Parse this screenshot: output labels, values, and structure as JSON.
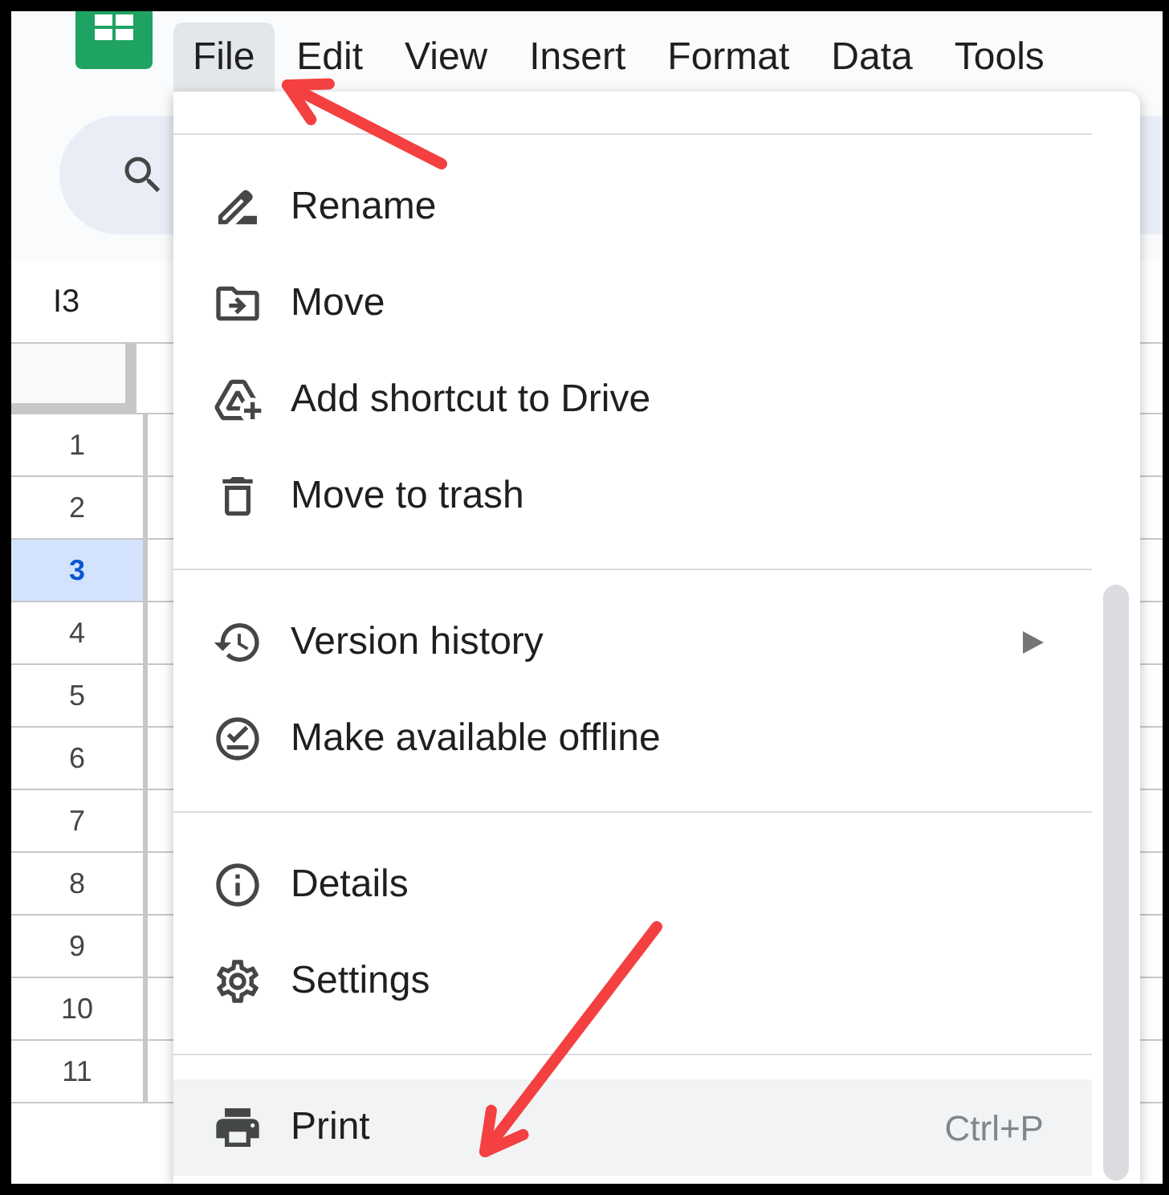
{
  "menubar": [
    {
      "label": "File",
      "selected": true
    },
    {
      "label": "Edit",
      "selected": false
    },
    {
      "label": "View",
      "selected": false
    },
    {
      "label": "Insert",
      "selected": false
    },
    {
      "label": "Format",
      "selected": false
    },
    {
      "label": "Data",
      "selected": false
    },
    {
      "label": "Tools",
      "selected": false
    }
  ],
  "name_box": "I3",
  "rows": [
    {
      "number": "1",
      "selected": false
    },
    {
      "number": "2",
      "selected": false
    },
    {
      "number": "3",
      "selected": true
    },
    {
      "number": "4",
      "selected": false
    },
    {
      "number": "5",
      "selected": false
    },
    {
      "number": "6",
      "selected": false
    },
    {
      "number": "7",
      "selected": false
    },
    {
      "number": "8",
      "selected": false
    },
    {
      "number": "9",
      "selected": false
    },
    {
      "number": "10",
      "selected": false
    },
    {
      "number": "11",
      "selected": false
    }
  ],
  "file_menu": {
    "sections": [
      [
        {
          "label": "Rename",
          "selected": false,
          "submenu": false
        },
        {
          "label": "Move",
          "selected": false,
          "submenu": false
        },
        {
          "label": "Add shortcut to Drive",
          "selected": false,
          "submenu": false
        },
        {
          "label": "Move to trash",
          "selected": false,
          "submenu": false
        }
      ],
      [
        {
          "label": "Version history",
          "selected": false,
          "submenu": true
        },
        {
          "label": "Make available offline",
          "selected": false,
          "submenu": false
        }
      ],
      [
        {
          "label": "Details",
          "selected": false,
          "submenu": false
        },
        {
          "label": "Settings",
          "selected": false,
          "submenu": false
        }
      ],
      [
        {
          "label": "Print",
          "selected": true,
          "submenu": false,
          "shortcut": "Ctrl+P"
        }
      ]
    ]
  }
}
